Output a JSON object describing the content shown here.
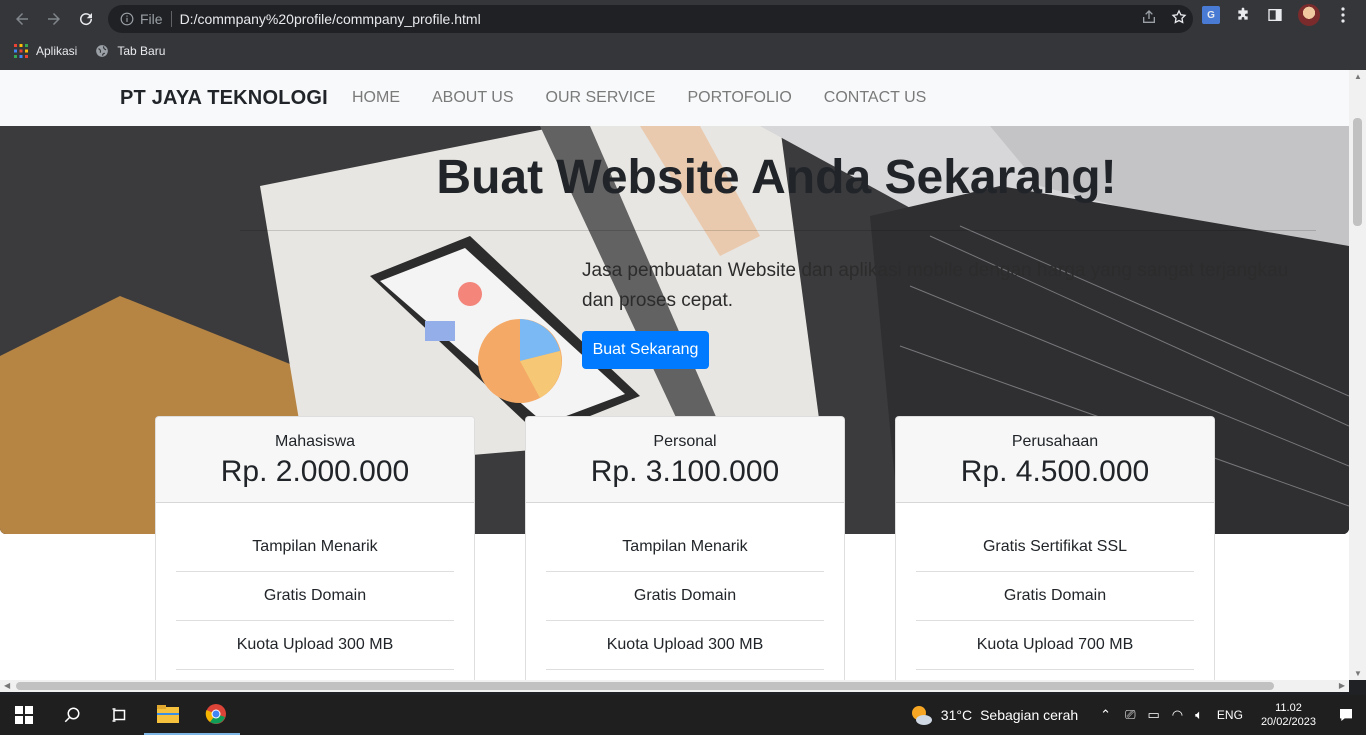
{
  "browser": {
    "file_label": "File",
    "url": "D:/commpany%20profile/commpany_profile.html",
    "bookmarks": [
      {
        "label": "Aplikasi",
        "icon": "apps-grid-icon"
      },
      {
        "label": "Tab Baru",
        "icon": "globe-icon"
      }
    ]
  },
  "navbar": {
    "brand": "PT JAYA TEKNOLOGI",
    "items": [
      "HOME",
      "ABOUT US",
      "OUR SERVICE",
      "PORTOFOLIO",
      "CONTACT US"
    ]
  },
  "hero": {
    "title": "Buat Website Anda Sekarang!",
    "lead": "Jasa pembuatan Website dan aplikasi mobile dengan harga yang sangat terjangkau dan proses cepat.",
    "button": "Buat Sekarang"
  },
  "pricing": [
    {
      "name": "Mahasiswa",
      "price": "Rp. 2.000.000",
      "features": [
        "Tampilan Menarik",
        "Gratis Domain",
        "Kuota Upload 300 MB"
      ]
    },
    {
      "name": "Personal",
      "price": "Rp. 3.100.000",
      "features": [
        "Tampilan Menarik",
        "Gratis Domain",
        "Kuota Upload 300 MB"
      ]
    },
    {
      "name": "Perusahaan",
      "price": "Rp. 4.500.000",
      "features": [
        "Gratis Sertifikat SSL",
        "Gratis Domain",
        "Kuota Upload 700 MB"
      ]
    }
  ],
  "taskbar": {
    "weather_temp": "31°C",
    "weather_desc": "Sebagian cerah",
    "lang": "ENG",
    "time": "11.02",
    "date": "20/02/2023"
  },
  "colors": {
    "primary": "#007bff",
    "navbar_bg": "#f8f9fa",
    "chrome_bg": "#35363a"
  }
}
